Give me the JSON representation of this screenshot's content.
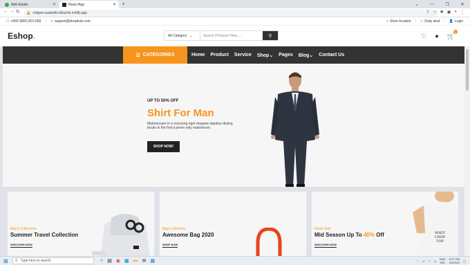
{
  "browser": {
    "tabs": [
      {
        "title": "Add details",
        "active": false
      },
      {
        "title": "React App",
        "active": true
      }
    ],
    "url": "chipper-pastelito-b6a2eb.netlify.app"
  },
  "topinfo": {
    "phone": "+060 (800) 801-582",
    "email": "support@shophub.com",
    "store_location": "Store location",
    "daily_deal": "Daily deal",
    "login": "Login"
  },
  "header": {
    "logo": "Eshop",
    "logo_dot": ".",
    "search_category": "All Category",
    "search_placeholder": "Search Products Here.....",
    "cart_count": "0"
  },
  "nav": {
    "categories": "CATEGORIES",
    "links": [
      "Home",
      "Product",
      "Service",
      "Shop",
      "Pages",
      "Blog",
      "Contact Us"
    ]
  },
  "hero": {
    "tag": "UP TO 50% OFF",
    "title": "Shirt For Man",
    "description": "Mabonosam in a nesciung eget magnae dapibus disting tloctio in the find it pereri odiy maboriosm.",
    "button": "SHOP NOW!"
  },
  "cards": [
    {
      "small": "Man's Collectons",
      "title": "Summer Travel Collection",
      "title_highlight": "",
      "title_after": "",
      "button": "DISCOVER NOW"
    },
    {
      "small": "Bag Collectons",
      "title": "Awesome Bag 2020",
      "title_highlight": "",
      "title_after": "",
      "button": "SHOP NOW"
    },
    {
      "small": "Flash Sale",
      "title": "Mid Season Up To ",
      "title_highlight": "40%",
      "title_after": " Off",
      "button": "DISCOVER NOW"
    }
  ],
  "tshirt_print": [
    "WHIT",
    "CROP",
    "TOP"
  ],
  "taskbar": {
    "search_placeholder": "Type here to search",
    "lang": "ENG",
    "region": "SRL",
    "time": "6:27 PM",
    "date": "2/9/2023"
  },
  "colors": {
    "accent": "#f7941d",
    "nav_bg": "#333333"
  }
}
